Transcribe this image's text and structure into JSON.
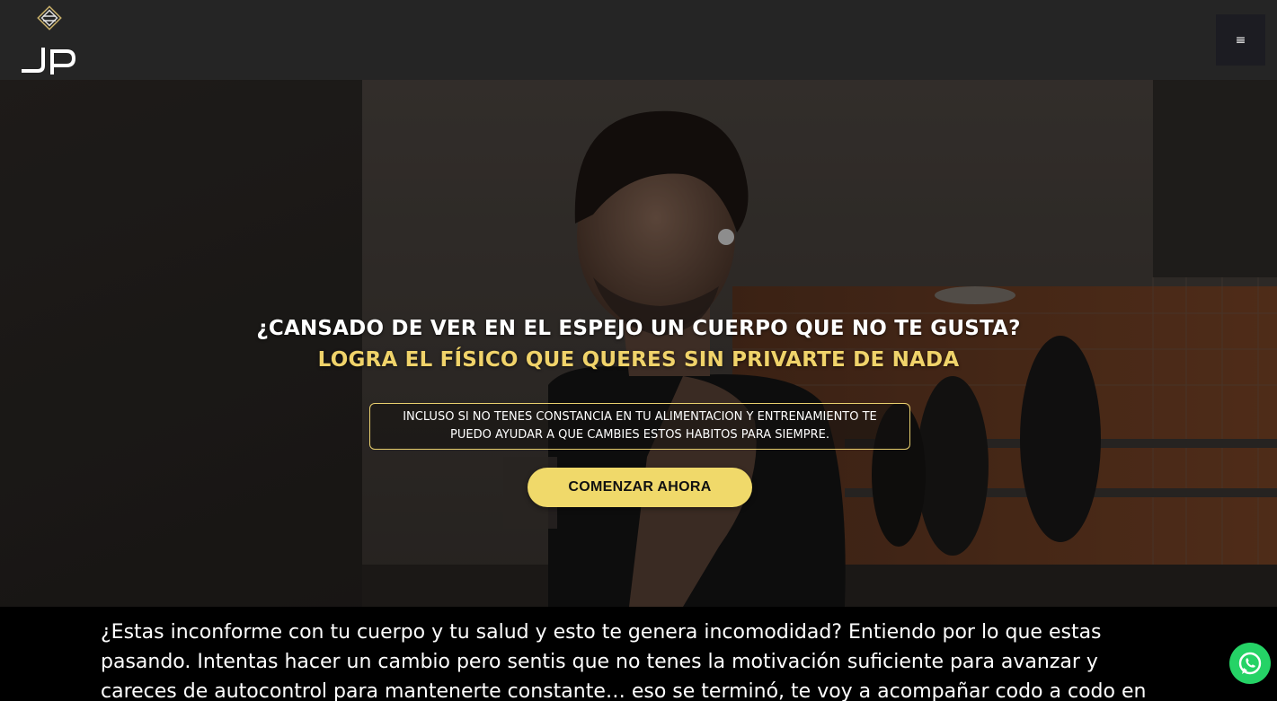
{
  "header": {
    "logo_text": "JP",
    "menu_icon": "hamburger-menu-icon",
    "menu_glyph": "≡"
  },
  "hero": {
    "headline": "¿CANSADO DE VER EN EL ESPEJO UN CUERPO QUE NO TE GUSTA?",
    "subheadline": "LOGRA EL FÍSICO QUE QUERES SIN PRIVARTE DE NADA",
    "notice": "INCLUSO SI NO TENES CONSTANCIA EN TU ALIMENTACION Y ENTRENAMIENTO TE PUEDO AYUDAR A QUE CAMBIES ESTOS HABITOS PARA SIEMPRE.",
    "cta_label": "COMENZAR AHORA"
  },
  "intro": {
    "text": "¿Estas inconforme con tu cuerpo y tu salud y esto te genera incomodidad? Entiendo por lo que estas pasando. Intentas hacer un cambio pero sentis que no tenes la motivación suficiente para avanzar y careces de autocontrol para mantenerte constante… eso se terminó, te voy a acompañar codo a codo en este proceso para que alcances"
  },
  "floating": {
    "whatsapp_icon": "whatsapp-icon"
  },
  "colors": {
    "accent": "#f0d96a",
    "header_bg": "#252525",
    "whatsapp": "#25d366"
  }
}
